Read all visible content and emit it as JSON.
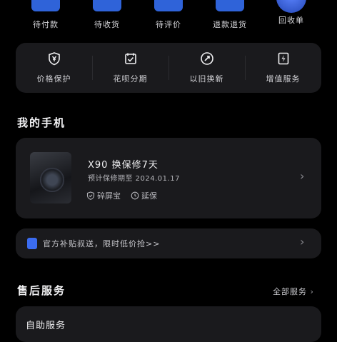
{
  "orders": [
    {
      "label": "待付款",
      "icon": "wallet-icon"
    },
    {
      "label": "待收货",
      "icon": "truck-icon"
    },
    {
      "label": "待评价",
      "icon": "chat-icon"
    },
    {
      "label": "退款退货",
      "icon": "refund-icon"
    },
    {
      "label": "回收单",
      "icon": "recycle-icon"
    }
  ],
  "services": [
    {
      "label": "价格保护",
      "icon": "shield-yen-icon"
    },
    {
      "label": "花呗分期",
      "icon": "calendar-check-icon"
    },
    {
      "label": "以旧换新",
      "icon": "exchange-icon"
    },
    {
      "label": "增值服务",
      "icon": "bolt-icon"
    }
  ],
  "my_phone": {
    "section_title": "我的手机",
    "name": "X90 换保修7天",
    "date": "预计保修期至 2024.01.17",
    "badge1": "碎屏宝",
    "badge2": "延保"
  },
  "promo": {
    "text": "官方补贴叔送，限时低价抢>>"
  },
  "aftersale": {
    "section_title": "售后服务",
    "link": "全部服务",
    "card_title": "自助服务"
  },
  "colors": {
    "background": "#000000",
    "card": "#1a1a1d",
    "accent": "#2f63d9"
  }
}
